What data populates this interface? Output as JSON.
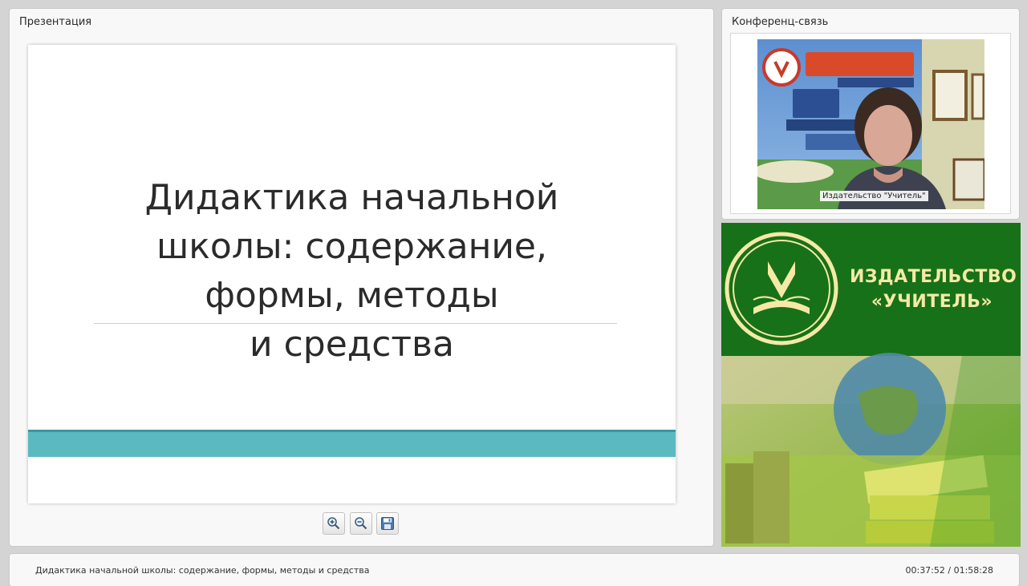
{
  "presentation_panel": {
    "title": "Презентация"
  },
  "slide": {
    "title": "Дидактика начальной\nшколы: содержание,\nформы, методы\nи средства",
    "band_color": "#5bb9c0"
  },
  "toolbar": {
    "zoom_in_icon": "zoom-in-icon",
    "zoom_out_icon": "zoom-out-icon",
    "save_icon": "floppy-disk-icon"
  },
  "conference_panel": {
    "title": "Конференц-связь",
    "speaker_label": "Издательство \"Учитель\""
  },
  "publisher_ad": {
    "name": "ИЗДАТЕЛЬСТВО\n«УЧИТЕЛЬ»",
    "brand_color": "#177118",
    "text_color": "#f6e9a5"
  },
  "footer": {
    "title": "Дидактика начальной школы: содержание, формы, методы и средства",
    "time": "00:37:52 / 01:58:28"
  }
}
